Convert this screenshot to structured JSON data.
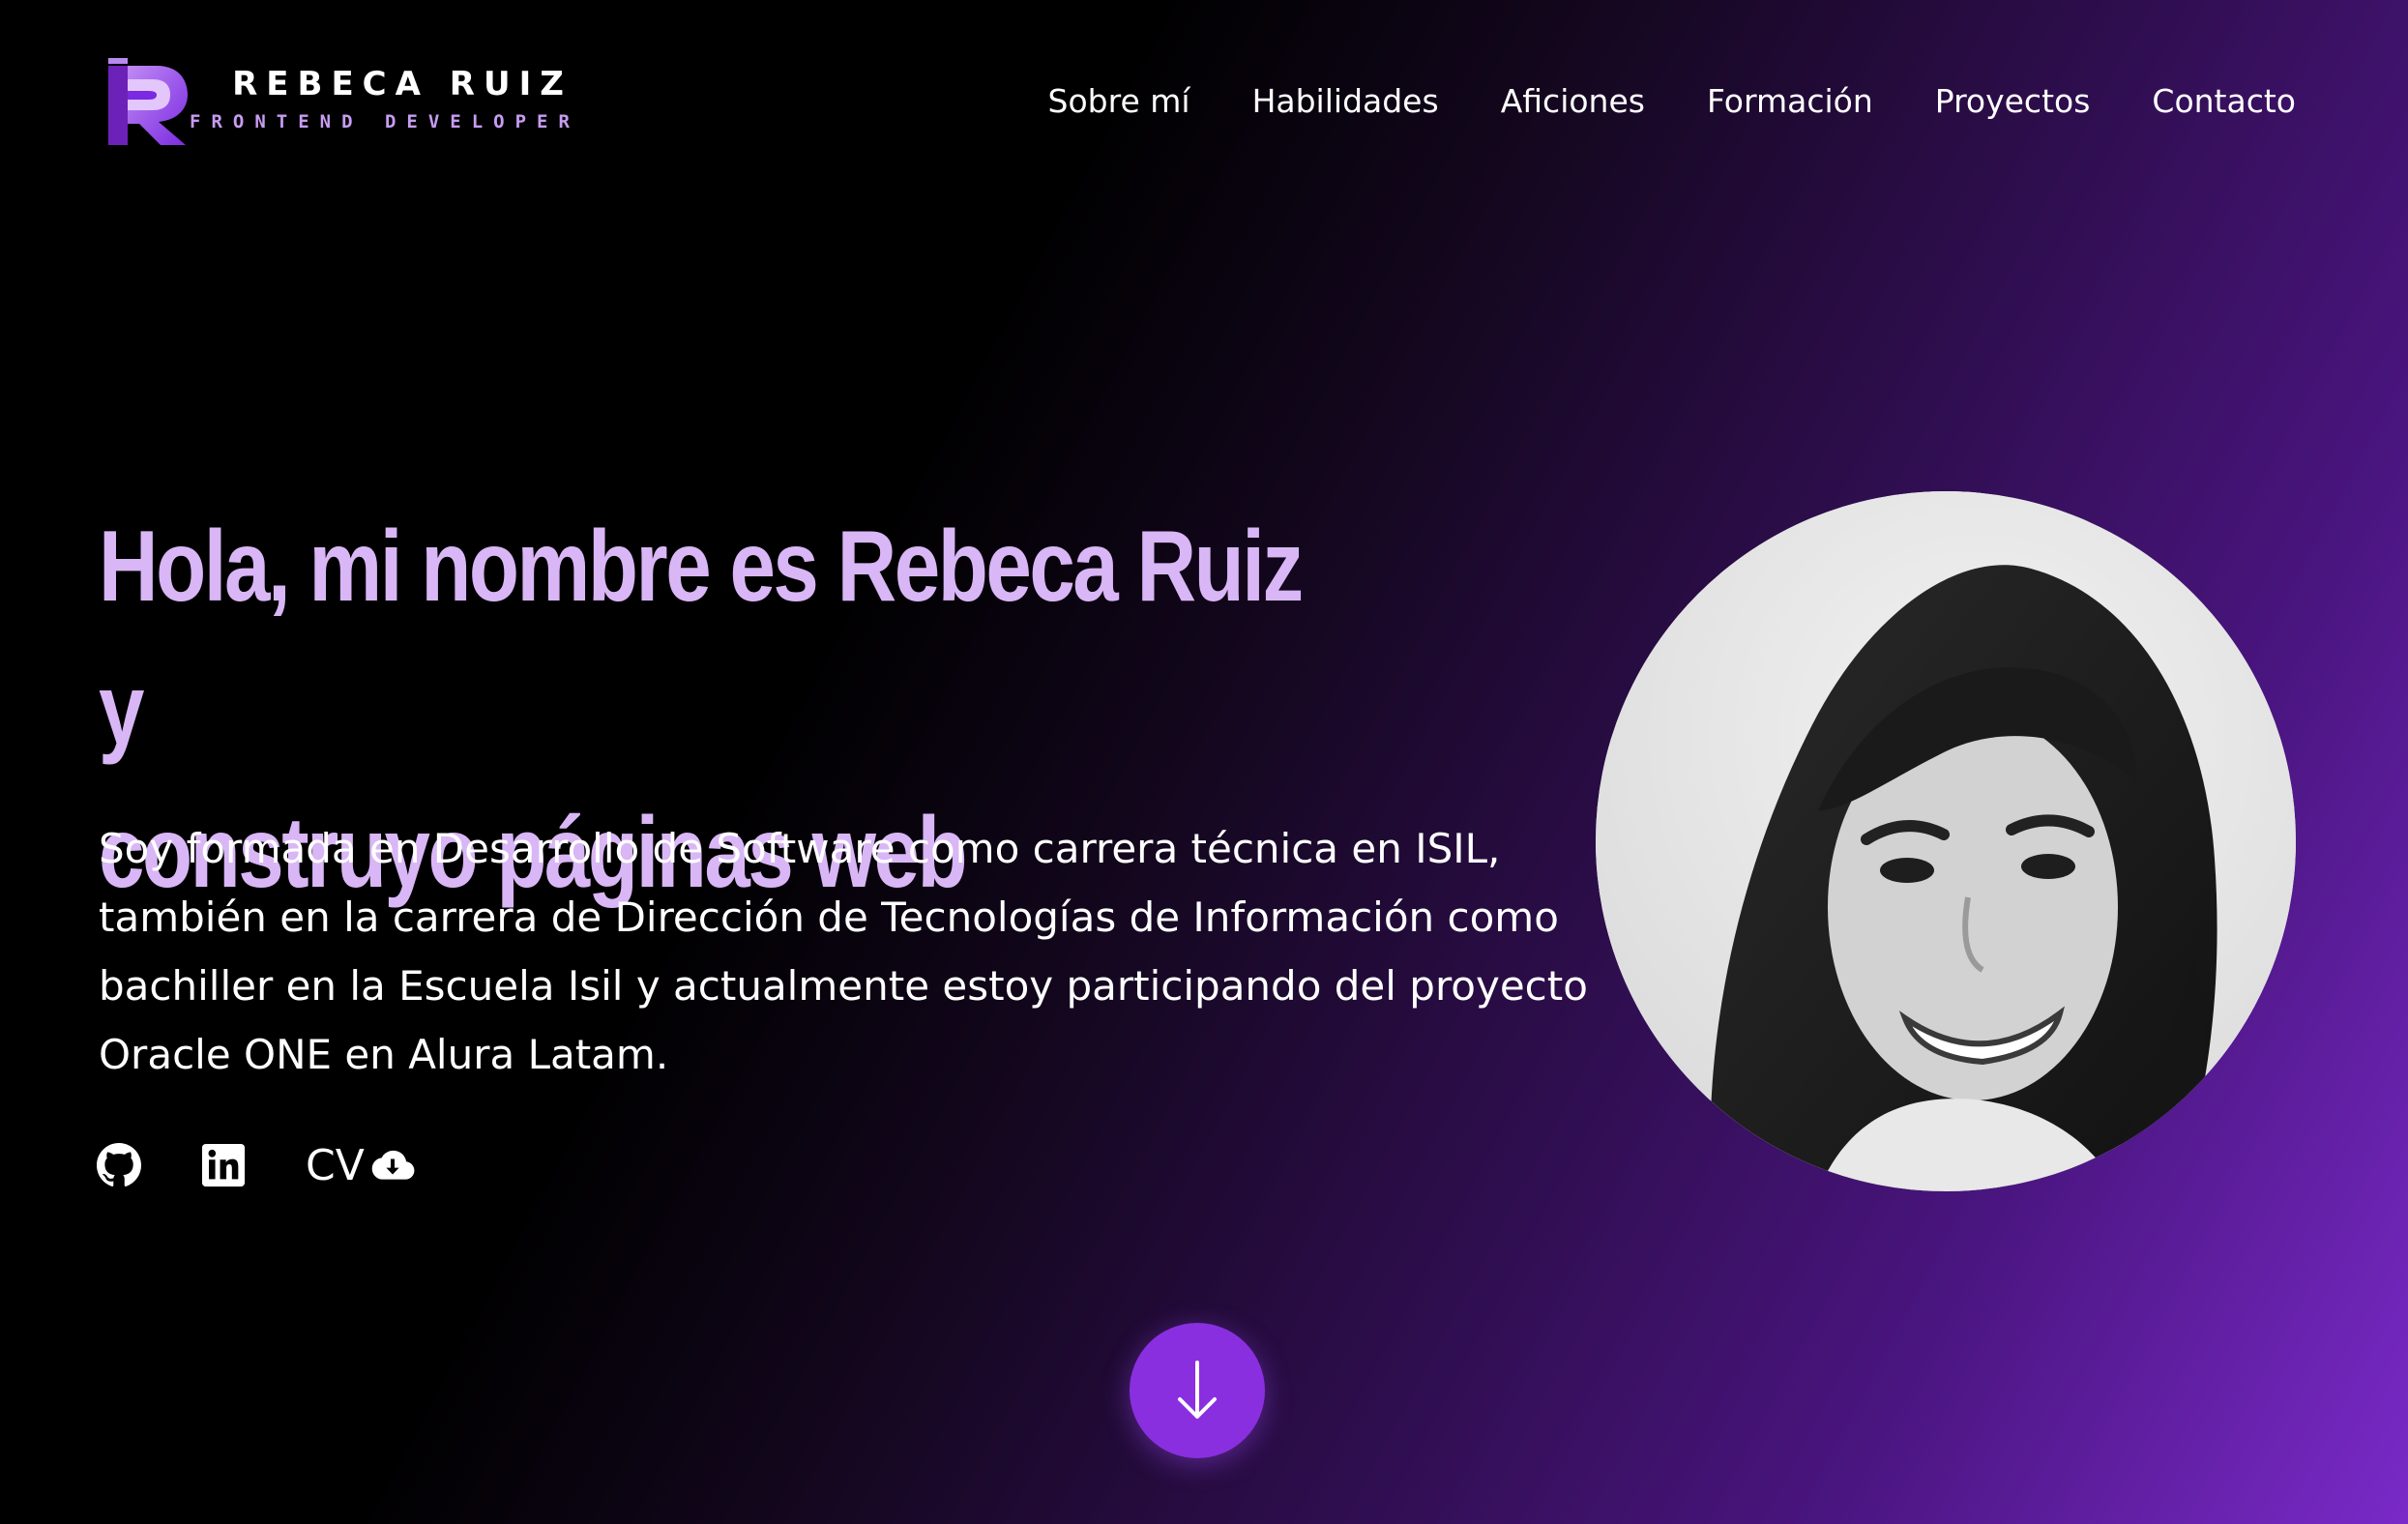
{
  "brand": {
    "name": "REBECA RUIZ",
    "role": "FRONTEND DEVELOPER",
    "logo_icon": "rr-monogram-logo"
  },
  "nav": {
    "items": [
      {
        "label": "Sobre mí"
      },
      {
        "label": "Habilidades"
      },
      {
        "label": "Aficiones"
      },
      {
        "label": "Formación"
      },
      {
        "label": "Proyectos"
      },
      {
        "label": "Contacto"
      }
    ]
  },
  "hero": {
    "title_line1": "Hola, mi nombre es Rebeca Ruiz y",
    "title_line2": "construyo páginas web",
    "description": "Soy formada en Desarrollo de Software como carrera técnica en ISIL, también en la carrera de Dirección de Tecnologías de Información como bachiller en la Escuela Isil y actualmente estoy participando del proyecto Oracle ONE en Alura Latam."
  },
  "socials": {
    "github_icon": "github-icon",
    "linkedin_icon": "linkedin-icon",
    "cv_label": "CV",
    "cv_icon": "cloud-download-icon"
  },
  "scroll": {
    "icon": "arrow-down-icon"
  },
  "colors": {
    "accent": "#8a2fe0",
    "title": "#d9b6f5",
    "role_text": "#c79cf2",
    "gradient_end": "#7a2ac8"
  }
}
